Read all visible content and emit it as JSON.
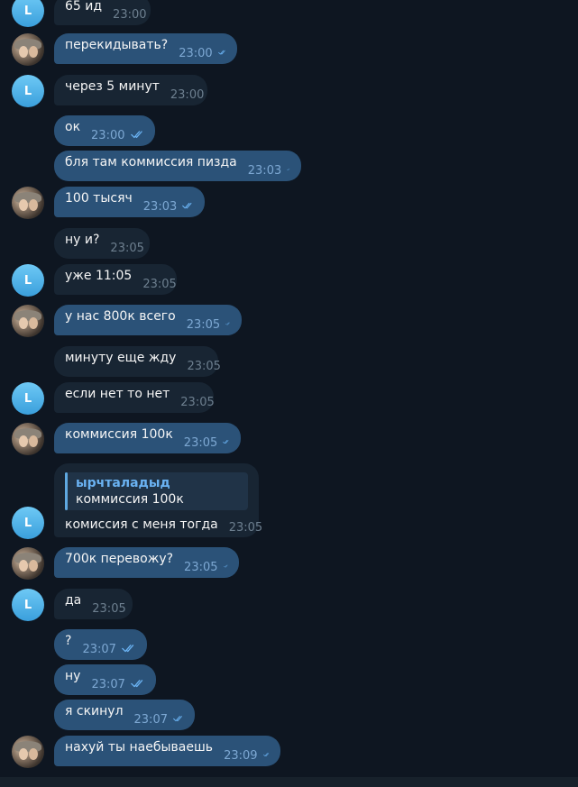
{
  "colors": {
    "background": "#0e1621",
    "incoming_bubble": "#182533",
    "outgoing_bubble": "#2b5278",
    "read_ticks": "#6ab2f2",
    "avatar_l": "#3a9fdc"
  },
  "contact_initial": "L",
  "messages": [
    {
      "text": "65 ид",
      "time": "23:00",
      "direction": "in"
    },
    {
      "text": "перекидывать?",
      "time": "23:00",
      "direction": "out",
      "status": "read"
    },
    {
      "text": "через 5 минут",
      "time": "23:00",
      "direction": "in"
    },
    {
      "text": "ок",
      "time": "23:00",
      "direction": "out",
      "status": "read"
    },
    {
      "text": "бля там коммиссия пизда",
      "time": "23:03",
      "direction": "out",
      "status": "read"
    },
    {
      "text": "100 тысяч",
      "time": "23:03",
      "direction": "out",
      "status": "read"
    },
    {
      "text": "ну и?",
      "time": "23:05",
      "direction": "in"
    },
    {
      "text": "уже 11:05",
      "time": "23:05",
      "direction": "in"
    },
    {
      "text": "у нас 800к всего",
      "time": "23:05",
      "direction": "out",
      "status": "read"
    },
    {
      "text": "минуту еще жду",
      "time": "23:05",
      "direction": "in"
    },
    {
      "text": "если нет то нет",
      "time": "23:05",
      "direction": "in"
    },
    {
      "text": "коммиссия 100к",
      "time": "23:05",
      "direction": "out",
      "status": "read"
    },
    {
      "text": "комиссия с меня тогда",
      "time": "23:05",
      "direction": "in",
      "reply": {
        "author": "ырчталадыд",
        "text": "коммиссия 100к"
      }
    },
    {
      "text": "700к перевожу?",
      "time": "23:05",
      "direction": "out",
      "status": "read"
    },
    {
      "text": "да",
      "time": "23:05",
      "direction": "in"
    },
    {
      "text": "?",
      "time": "23:07",
      "direction": "out",
      "status": "read"
    },
    {
      "text": "ну",
      "time": "23:07",
      "direction": "out",
      "status": "read"
    },
    {
      "text": "я скинул",
      "time": "23:07",
      "direction": "out",
      "status": "read"
    },
    {
      "text": "нахуй ты наебываешь",
      "time": "23:09",
      "direction": "out",
      "status": "read"
    }
  ]
}
